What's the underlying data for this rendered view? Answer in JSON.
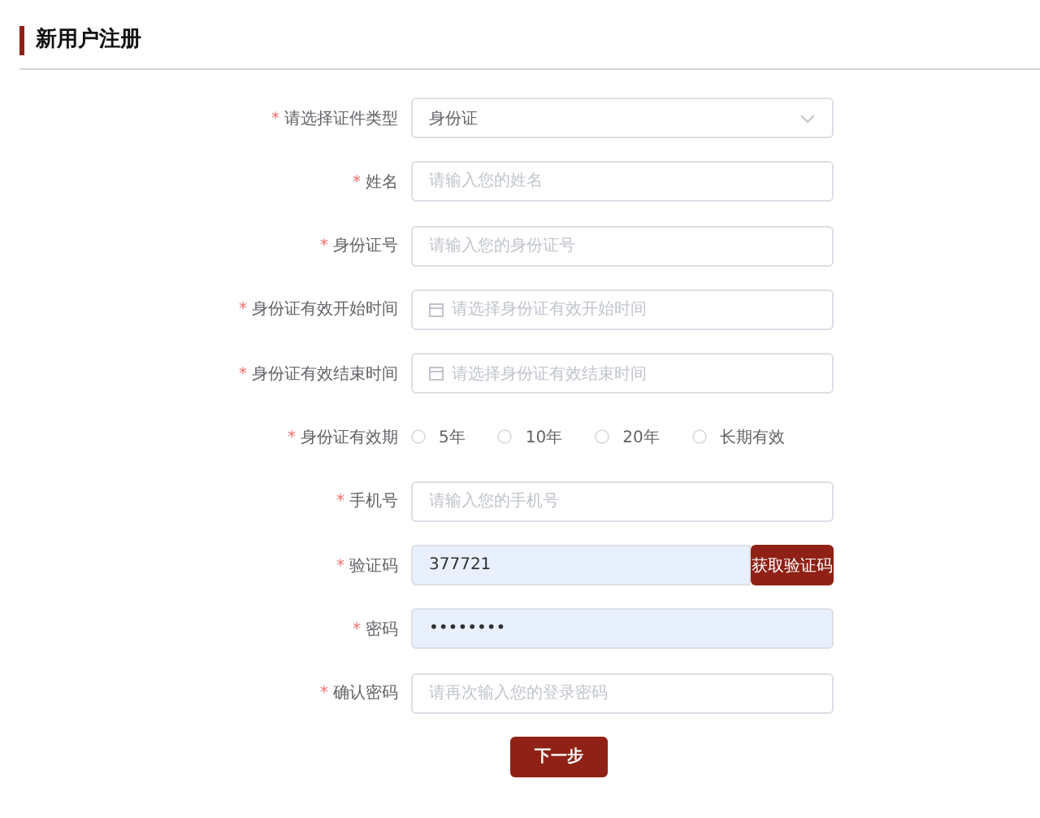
{
  "title": "新用户注册",
  "rows": [
    {
      "kind": "select",
      "required_mark": "*",
      "label": "请选择证件类型",
      "value": "身份证"
    },
    {
      "kind": "text",
      "required_mark": "*",
      "label": "姓名",
      "placeholder": "请输入您的姓名"
    },
    {
      "kind": "text",
      "required_mark": "*",
      "label": "身份证号",
      "placeholder": "请输入您的身份证号"
    },
    {
      "kind": "date",
      "required_mark": "*",
      "label": "身份证有效开始时间",
      "placeholder": "请选择身份证有效开始时间"
    },
    {
      "kind": "date",
      "required_mark": "*",
      "label": "身份证有效结束时间",
      "placeholder": "请选择身份证有效结束时间"
    },
    {
      "kind": "radio",
      "required_mark": "*",
      "label": "身份证有效期",
      "options": [
        {
          "label": "5年",
          "selected": false
        },
        {
          "label": "10年",
          "selected": false
        },
        {
          "label": "20年",
          "selected": false
        },
        {
          "label": "长期有效",
          "selected": false
        }
      ]
    },
    {
      "kind": "text",
      "required_mark": "*",
      "label": "手机号",
      "placeholder": "请输入您的手机号"
    },
    {
      "kind": "code",
      "required_mark": "*",
      "label": "验证码",
      "value": "377721",
      "autofilled": true,
      "button": "获取验证码"
    },
    {
      "kind": "text",
      "required_mark": "*",
      "label": "密码",
      "value": "••••••••",
      "autofilled": true
    },
    {
      "kind": "text",
      "required_mark": "*",
      "label": "确认密码",
      "placeholder": "请再次输入您的登录密码"
    }
  ],
  "submit": "下一步"
}
